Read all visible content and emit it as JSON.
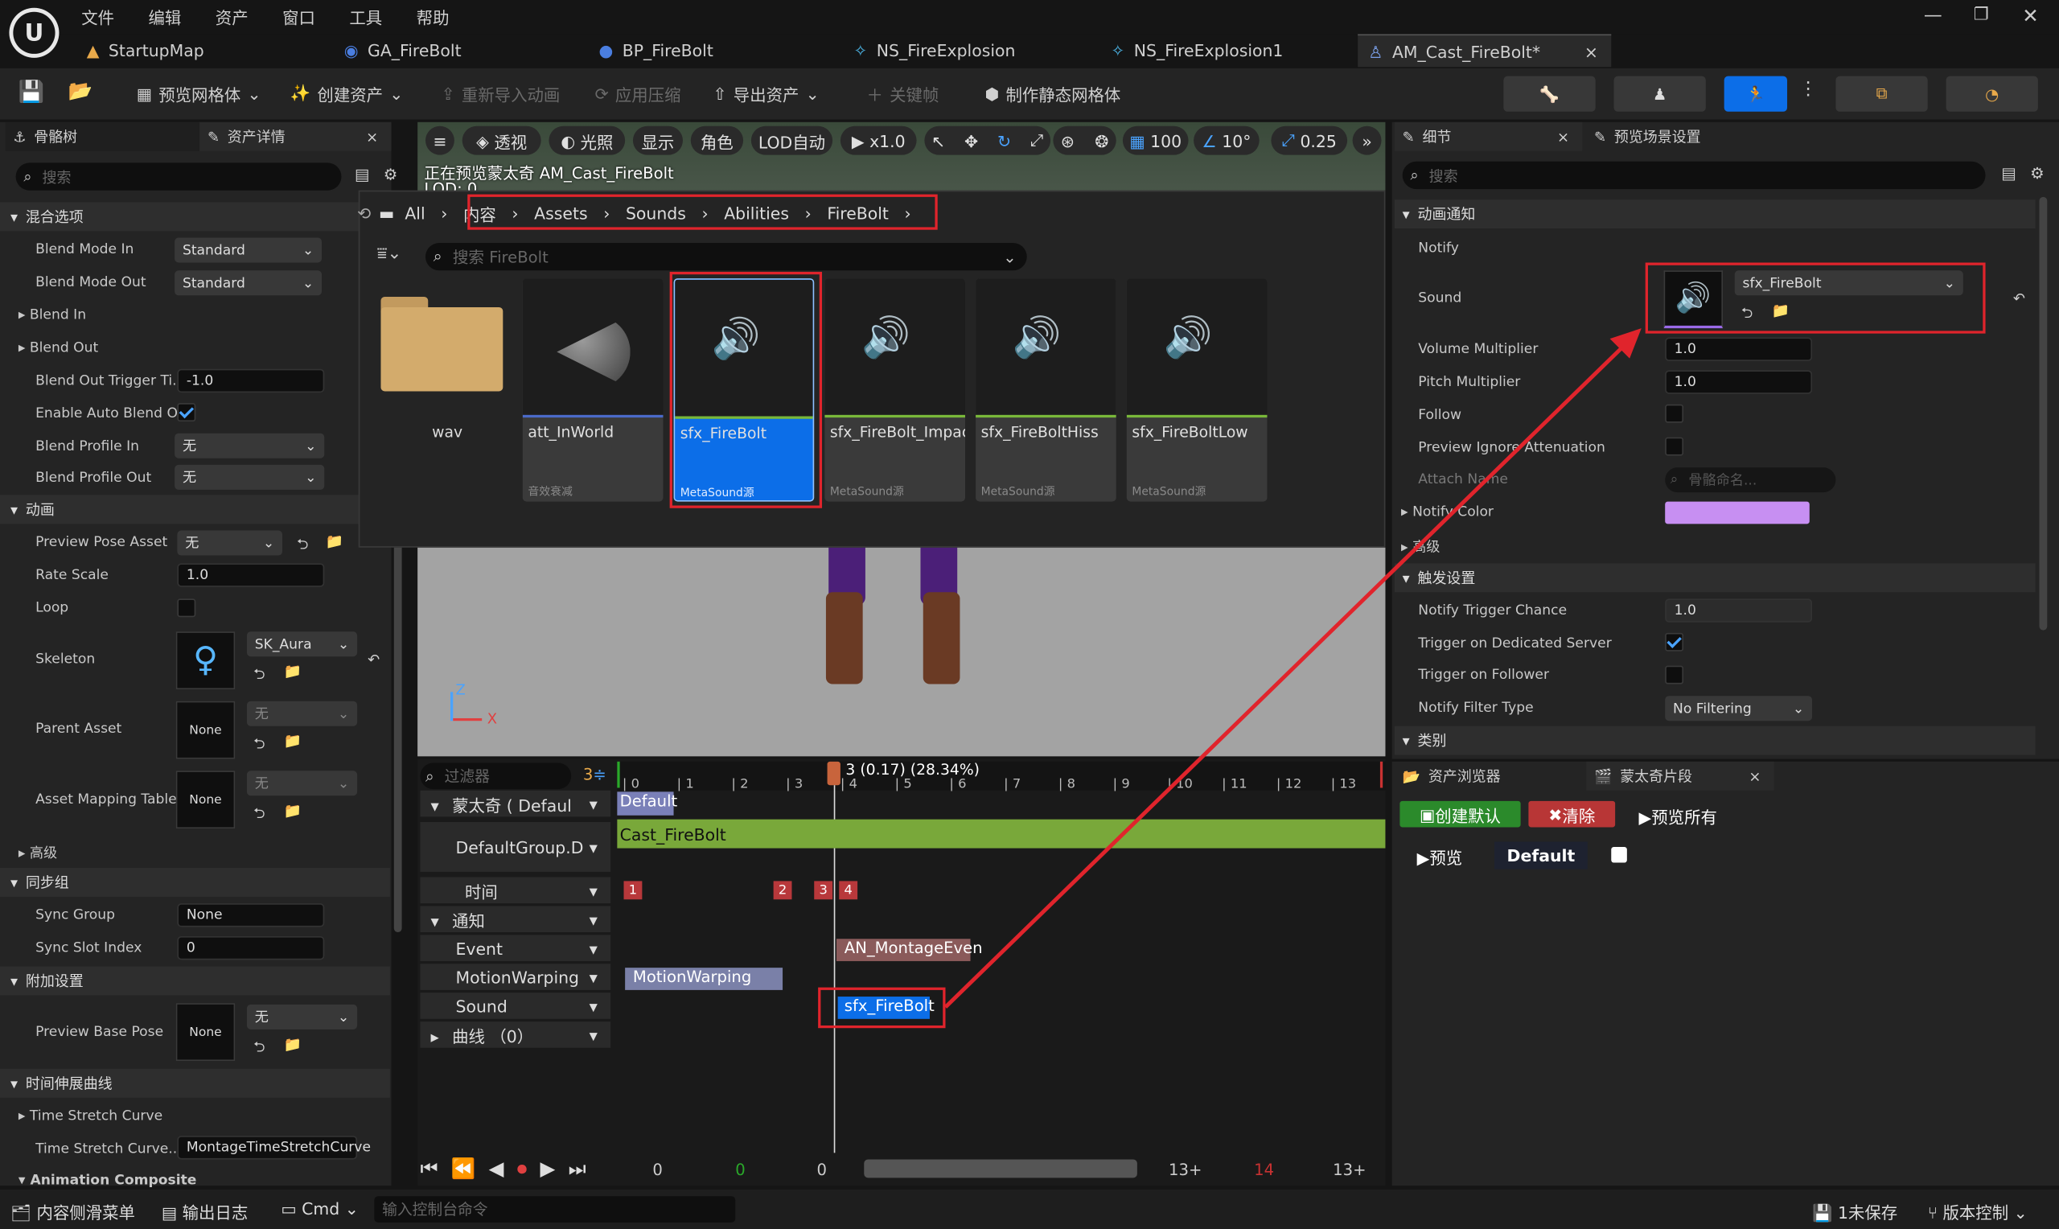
{
  "menu": [
    "文件",
    "编辑",
    "资产",
    "窗口",
    "工具",
    "帮助"
  ],
  "tabs": [
    {
      "label": "StartupMap"
    },
    {
      "label": "GA_FireBolt"
    },
    {
      "label": "BP_FireBolt"
    },
    {
      "label": "NS_FireExplosion"
    },
    {
      "label": "NS_FireExplosion1"
    },
    {
      "label": "AM_Cast_FireBolt*",
      "close": "×"
    }
  ],
  "toolbar": {
    "preview_mesh": "预览网格体",
    "create_asset": "创建资产",
    "reimport": "重新导入动画",
    "apply_compression": "应用压缩",
    "export_asset": "导出资产",
    "keyframe": "关键帧",
    "make_static_mesh": "制作静态网格体"
  },
  "left_panel": {
    "tab_skeleton": "骨骼树",
    "tab_asset_details": "资产详情",
    "close": "×",
    "search_placeholder": "搜索",
    "sections": {
      "blend": "混合选项",
      "animation": "动画",
      "advanced": "高级",
      "sync": "同步组",
      "additive": "附加设置",
      "time_stretch": "时间伸展曲线",
      "anim_composite": "Animation Composite"
    },
    "props": {
      "blend_mode_in": "Blend Mode In",
      "blend_mode_in_val": "Standard",
      "blend_mode_out": "Blend Mode Out",
      "blend_mode_out_val": "Standard",
      "blend_in": "Blend In",
      "blend_out": "Blend Out",
      "blend_out_trigger": "Blend Out Trigger Ti...",
      "blend_out_trigger_val": "-1.0",
      "enable_auto_blend": "Enable Auto Blend O...",
      "blend_profile_in": "Blend Profile In",
      "blend_profile_in_val": "无",
      "blend_profile_out": "Blend Profile Out",
      "blend_profile_out_val": "无",
      "preview_pose_asset": "Preview Pose Asset",
      "preview_pose_asset_val": "无",
      "rate_scale": "Rate Scale",
      "rate_scale_val": "1.0",
      "loop": "Loop",
      "skeleton": "Skeleton",
      "skeleton_val": "SK_Aura",
      "parent_asset": "Parent Asset",
      "parent_asset_thumb": "None",
      "parent_asset_val": "无",
      "asset_mapping": "Asset Mapping Table",
      "asset_mapping_thumb": "None",
      "asset_mapping_val": "无",
      "sync_group": "Sync Group",
      "sync_group_val": "None",
      "sync_slot": "Sync Slot Index",
      "sync_slot_val": "0",
      "preview_base_pose": "Preview Base Pose",
      "preview_base_pose_thumb": "None",
      "preview_base_pose_val": "无",
      "time_stretch_curve": "Time Stretch Curve",
      "time_stretch_curve_name": "Time Stretch Curve...",
      "time_stretch_curve_name_val": "MontageTimeStretchCurve"
    }
  },
  "viewport": {
    "buttons": {
      "perspective": "透视",
      "lit": "光照",
      "show": "显示",
      "character": "角色",
      "lod": "LOD自动",
      "speed": "x1.0",
      "grid": "100",
      "angle": "10°",
      "scale": "0.25"
    },
    "overlay_text": "正在预览蒙太奇 AM_Cast_FireBolt",
    "overlay_text2": "LOD: 0",
    "axis_z": "Z",
    "axis_x": "X"
  },
  "asset_picker": {
    "breadcrumb": [
      "All",
      "内容",
      "Assets",
      "Sounds",
      "Abilities",
      "FireBolt"
    ],
    "search_placeholder": "搜索 FireBolt",
    "items": [
      {
        "name": "wav",
        "type": ""
      },
      {
        "name": "att_InWorld",
        "type": "音效衰减"
      },
      {
        "name": "sfx_FireBolt",
        "type": "MetaSound源"
      },
      {
        "name": "sfx_FireBolt_Impact",
        "type": "MetaSound源"
      },
      {
        "name": "sfx_FireBoltHiss",
        "type": "MetaSound源"
      },
      {
        "name": "sfx_FireBoltLow",
        "type": "MetaSound源"
      }
    ]
  },
  "timeline": {
    "filter_placeholder": "过滤器",
    "filter_count": "3",
    "playhead": "3 (0.17) (28.34%)",
    "tracks": {
      "montage": "蒙太奇 ( Defaul",
      "default_group": "DefaultGroup.D",
      "time": "时间",
      "notify": "通知",
      "event": "Event",
      "motion_warping": "MotionWarping",
      "sound": "Sound",
      "curves": "曲线 （0）"
    },
    "ticks": [
      "0",
      "1",
      "2",
      "3",
      "4",
      "5",
      "6",
      "7",
      "8",
      "9",
      "10",
      "11",
      "12",
      "13"
    ],
    "section_default": "Default",
    "segment_name": "Cast_FireBolt",
    "markers": [
      "1",
      "2",
      "3",
      "4"
    ],
    "notify_event": "AN_MontageEven",
    "notify_warp": "MotionWarping",
    "notify_sound": "sfx_FireBolt",
    "transport": {
      "start": "0",
      "green": "0",
      "cur": "0",
      "end_a": "13",
      "end_red": "14",
      "end_b": "13"
    }
  },
  "details": {
    "tab_details": "细节",
    "tab_scene": "预览场景设置",
    "close": "×",
    "search_placeholder": "搜索",
    "sections": {
      "anim_notify": "动画通知",
      "advanced": "高级",
      "trigger": "触发设置",
      "category": "类别"
    },
    "props": {
      "notify": "Notify",
      "sound": "Sound",
      "sound_val": "sfx_FireBolt",
      "volume": "Volume Multiplier",
      "volume_val": "1.0",
      "pitch": "Pitch Multiplier",
      "pitch_val": "1.0",
      "follow": "Follow",
      "preview_ignore": "Preview Ignore Attenuation",
      "attach_name": "Attach Name",
      "attach_placeholder": "骨骼命名...",
      "notify_color": "Notify Color",
      "trigger_chance": "Notify Trigger Chance",
      "trigger_chance_val": "1.0",
      "trigger_server": "Trigger on Dedicated Server",
      "trigger_follower": "Trigger on Follower",
      "filter_type": "Notify Filter Type",
      "filter_type_val": "No Filtering"
    },
    "notify_color_hex": "#c78ff2"
  },
  "bottom_right": {
    "tab_content": "资产浏览器",
    "tab_montage": "蒙太奇片段",
    "close": "×",
    "create_default": "创建默认",
    "clear": "清除",
    "preview_all": "预览所有",
    "preview": "预览",
    "default": "Default"
  },
  "statusbar": {
    "content_drawer": "内容侧滑菜单",
    "output_log": "输出日志",
    "cmd": "Cmd",
    "console_placeholder": "输入控制台命令",
    "unsaved": "1未保存",
    "source_control": "版本控制"
  },
  "colors": {
    "accent": "#0c6ee8",
    "red_highlight": "#e0242c",
    "green_bar": "#79b83a"
  }
}
